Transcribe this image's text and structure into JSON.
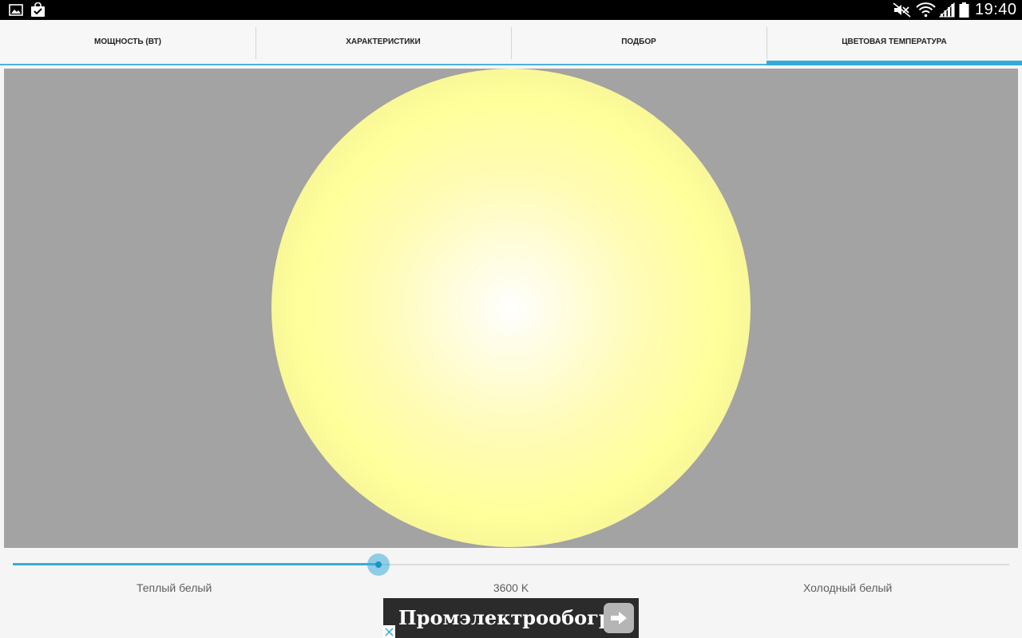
{
  "status_bar": {
    "time": "19:40",
    "notification_icons": [
      "gallery-icon",
      "shopping-bag-check-icon"
    ],
    "system_icons": [
      "mute-icon",
      "wifi-icon",
      "signal-icon",
      "battery-icon"
    ]
  },
  "tabs": [
    {
      "label": "МОЩНОСТЬ (ВТ)",
      "active": false
    },
    {
      "label": "ХАРАКТЕРИСТИКИ",
      "active": false
    },
    {
      "label": "ПОДБОР",
      "active": false
    },
    {
      "label": "ЦВЕТОВАЯ ТЕМПЕРАТУРА",
      "active": true
    }
  ],
  "preview": {
    "background_color": "#a3a3a3",
    "lamp_color": "#ffff9a"
  },
  "slider": {
    "fraction": 0.367,
    "accent_color": "#39abd8"
  },
  "labels": {
    "warm": "Теплый белый",
    "value": "3600 K",
    "cold": "Холодный белый"
  },
  "ad": {
    "text": "Промэлектрообогрев",
    "icons": [
      "arrow-right-icon",
      "close-icon"
    ]
  }
}
